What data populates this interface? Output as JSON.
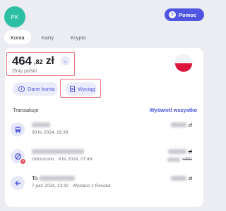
{
  "header": {
    "avatar_initials": "PK",
    "help_label": "Pomoc",
    "help_icon": "?"
  },
  "tabs": [
    {
      "label": "Konta",
      "active": true
    },
    {
      "label": "Karty",
      "active": false
    },
    {
      "label": "Krypto",
      "active": false
    }
  ],
  "account": {
    "balance_main": "464",
    "balance_cents": ",82",
    "currency_symbol": "zł",
    "currency_name": "Złoty polski",
    "chevron": "⌄",
    "flag": "poland-flag"
  },
  "actions": {
    "details_label": "Dane konta",
    "details_icon": "i",
    "statement_label": "Wyciąg"
  },
  "transactions": {
    "title": "Transakcje",
    "see_all_label": "Wyświetl wszystko",
    "items": [
      {
        "icon": "bus-icon",
        "subtitle": "30 lis 2024, 16:38",
        "currency": "zł"
      },
      {
        "icon": "cancelled-icon",
        "subtitle": "Odrzucono · 9 lis 2024, 07:49",
        "currency": "zł",
        "secondary_currency": "USD"
      },
      {
        "icon": "transfer-arrow-icon",
        "title_prefix": "To",
        "subtitle": "7 paź 2024, 13:42 · Wysłano z Revolut",
        "currency": "zł"
      }
    ]
  },
  "colors": {
    "accent": "#4f55e0",
    "avatar": "#2dbfa3",
    "highlight_box": "#e3737f",
    "declined_badge": "#e04a5a"
  }
}
